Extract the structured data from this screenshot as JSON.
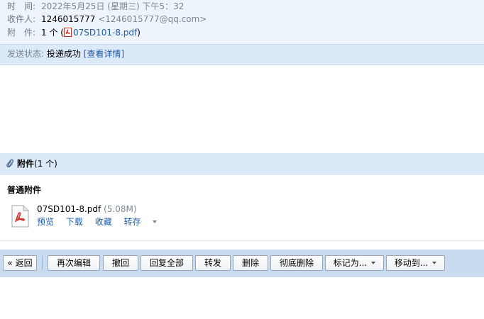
{
  "header": {
    "time_label": "时　间:",
    "time_value": "2022年5月25日 (星期三) 下午5：32",
    "recipient_label": "收件人:",
    "recipient_name": "1246015777",
    "recipient_email": "<1246015777@qq.com>",
    "attachment_label": "附　件:",
    "attachment_count": "1 个 (",
    "attachment_file": "07SD101-8.pdf",
    "attachment_close": ")"
  },
  "send_status": {
    "label": "发送状态:",
    "value": "投递成功",
    "details_link": "[查看详情]"
  },
  "attachments": {
    "title": "附件",
    "count": "(1 个)",
    "section_title": "普通附件",
    "file": {
      "name": "07SD101-8.pdf",
      "size": "(5.08M)",
      "icon": "pdf-file-icon",
      "actions": [
        "预览",
        "下载",
        "收藏",
        "转存"
      ]
    }
  },
  "toolbar": {
    "back": "« 返回",
    "edit_again": "再次编辑",
    "recall": "撤回",
    "reply_all": "回复全部",
    "forward": "转发",
    "delete": "删除",
    "delete_permanently": "彻底删除",
    "mark_as": "标记为...",
    "move_to": "移动到..."
  },
  "colors": {
    "link": "#1f5aa6",
    "header_bg": "#eef4fb",
    "bar_bg": "#dce9f8",
    "toolbar_bg": "#c8dbf1",
    "pdf_red": "#d9261c"
  }
}
